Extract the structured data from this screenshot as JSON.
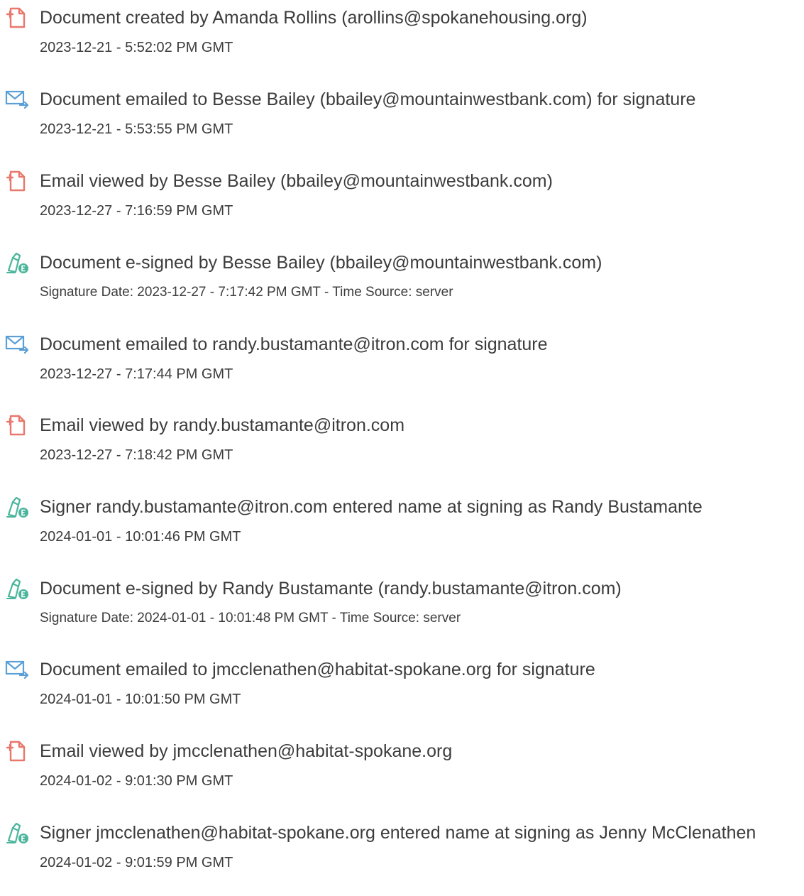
{
  "events": [
    {
      "icon": "document-created-icon",
      "text": "Document created by Amanda Rollins (arollins@spokanehousing.org)",
      "date": "2023-12-21 - 5:52:02 PM GMT"
    },
    {
      "icon": "email-sent-icon",
      "text": "Document emailed to Besse Bailey (bbailey@mountainwestbank.com) for signature",
      "date": "2023-12-21 - 5:53:55 PM GMT"
    },
    {
      "icon": "email-viewed-icon",
      "text": "Email viewed by Besse Bailey (bbailey@mountainwestbank.com)",
      "date": "2023-12-27 - 7:16:59 PM GMT"
    },
    {
      "icon": "e-signed-icon",
      "text": "Document e-signed by Besse Bailey (bbailey@mountainwestbank.com)",
      "date": "Signature Date: 2023-12-27 - 7:17:42 PM GMT - Time Source: server"
    },
    {
      "icon": "email-sent-icon",
      "text": "Document emailed to randy.bustamante@itron.com for signature",
      "date": "2023-12-27 - 7:17:44 PM GMT"
    },
    {
      "icon": "email-viewed-icon",
      "text": "Email viewed by randy.bustamante@itron.com",
      "date": "2023-12-27 - 7:18:42 PM GMT"
    },
    {
      "icon": "signer-name-icon",
      "text": "Signer randy.bustamante@itron.com entered name at signing as Randy Bustamante",
      "date": "2024-01-01 - 10:01:46 PM GMT"
    },
    {
      "icon": "e-signed-icon",
      "text": "Document e-signed by Randy Bustamante (randy.bustamante@itron.com)",
      "date": "Signature Date: 2024-01-01 - 10:01:48 PM GMT - Time Source: server"
    },
    {
      "icon": "email-sent-icon",
      "text": "Document emailed to jmcclenathen@habitat-spokane.org for signature",
      "date": "2024-01-01 - 10:01:50 PM GMT"
    },
    {
      "icon": "email-viewed-icon",
      "text": "Email viewed by jmcclenathen@habitat-spokane.org",
      "date": "2024-01-02 - 9:01:30 PM GMT"
    },
    {
      "icon": "signer-name-icon",
      "text": "Signer jmcclenathen@habitat-spokane.org entered name at signing as Jenny McClenathen",
      "date": "2024-01-02 - 9:01:59 PM GMT"
    }
  ]
}
